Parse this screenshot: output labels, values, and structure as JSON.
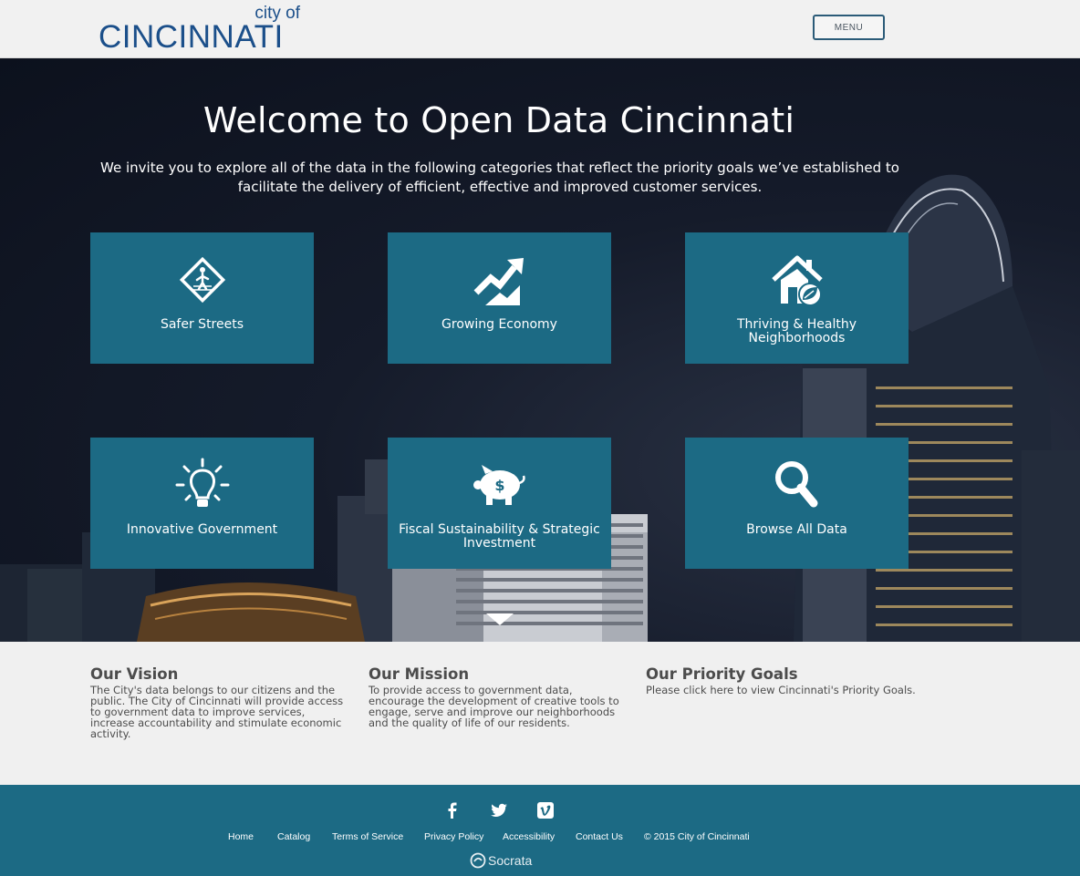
{
  "header": {
    "logo_small": "city of",
    "logo_main": "CINCINNATI",
    "menu_label": "MENU"
  },
  "hero": {
    "title": "Welcome to Open Data Cincinnati",
    "intro": "We invite you to explore all of the data in the following categories that reflect the priority goals we’ve established to facilitate the delivery of efficient, effective and improved customer services.",
    "tiles": [
      {
        "label": "Safer Streets",
        "icon": "pedestrian-crossing-icon"
      },
      {
        "label": "Growing Economy",
        "icon": "trend-up-icon"
      },
      {
        "label": "Thriving & Healthy Neighborhoods",
        "icon": "house-leaf-icon"
      },
      {
        "label": "Innovative Government",
        "icon": "lightbulb-icon"
      },
      {
        "label": "Fiscal Sustainability & Strategic Investment",
        "icon": "piggy-bank-icon"
      },
      {
        "label": "Browse All Data",
        "icon": "search-icon"
      }
    ]
  },
  "info": {
    "vision": {
      "title": "Our Vision",
      "text": "The City's data belongs to our citizens and the public. The City of Cincinnati will provide access to government data to improve services, increase accountability and stimulate economic activity."
    },
    "mission": {
      "title": "Our Mission",
      "text": "To provide access to government data, encourage the development of creative tools to engage, serve and improve our neighborhoods and the quality of life of our residents."
    },
    "goals": {
      "title": "Our Priority Goals",
      "text": "Please click here to view Cincinnati's Priority Goals."
    }
  },
  "footer": {
    "social": [
      "facebook-icon",
      "twitter-icon",
      "vimeo-icon"
    ],
    "links": {
      "home": "Home",
      "catalog": "Catalog",
      "terms": "Terms of Service",
      "privacy": "Privacy Policy",
      "accessibility": "Accessibility",
      "contact": "Contact Us",
      "copyright": "© 2015 City of Cincinnati"
    },
    "powered_by": "Socrata"
  },
  "colors": {
    "tile": "#1c6a84",
    "footer": "#1c6a84",
    "logo": "#1b4f8a",
    "hero_bg": "#151b2a"
  }
}
